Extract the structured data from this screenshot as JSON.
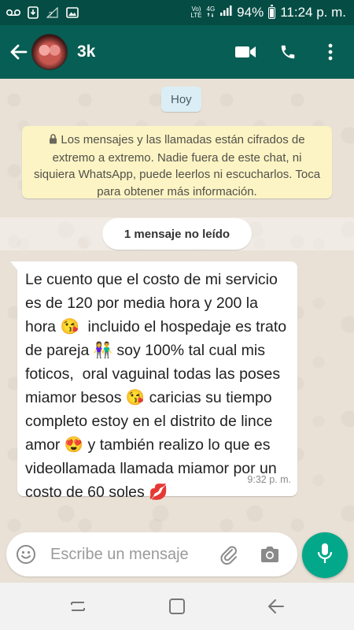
{
  "status_bar": {
    "icons_left": [
      "voicemail-icon",
      "download-icon",
      "no-signal-icon",
      "image-icon"
    ],
    "volte_top": "Vo)",
    "volte_bottom": "LTE",
    "network": "4G",
    "battery_percent": 94,
    "battery_label": "94%",
    "time": "11:24 p. m."
  },
  "header": {
    "contact_name": "3k",
    "icons": [
      "back-arrow-icon",
      "video-call-icon",
      "phone-icon",
      "more-vert-icon"
    ]
  },
  "chat": {
    "date_label": "Hoy",
    "encryption_notice": "Los mensajes y las llamadas están cifrados de extremo a extremo. Nadie fuera de este chat, ni siquiera WhatsApp, puede leerlos ni escucharlos. Toca para obtener más información.",
    "unread_label": "1 mensaje no leído",
    "message": {
      "text": "Le cuento que el costo de mi servicio es de 120 por media hora y 200 la hora 😘  incluido el hospedaje es trato de pareja 👫 soy 100% tal cual mis foticos,  oral vaguinal todas las poses miamor besos 😘 caricias su tiempo completo estoy en el distrito de lince amor 😍 y también realizo lo que es videollamada llamada miamor por un costo de 60 soles 💋",
      "time": "9:32 p. m."
    }
  },
  "input": {
    "placeholder": "Escribe un mensaje",
    "value": ""
  },
  "colors": {
    "header": "#075e54",
    "status_bar": "#054d44",
    "accent": "#03a88a",
    "encryption_bg": "#fcf4c4",
    "date_chip_bg": "#dbeef5"
  }
}
